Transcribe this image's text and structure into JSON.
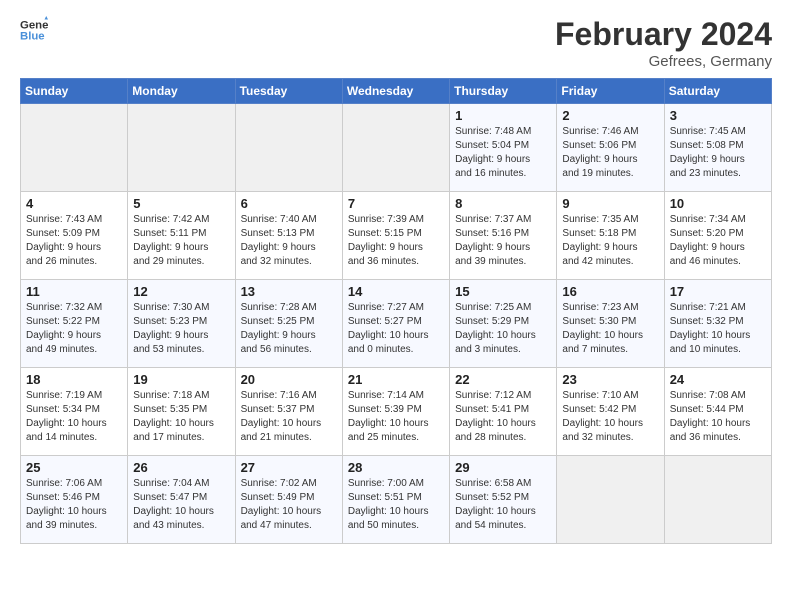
{
  "header": {
    "logo_line1": "General",
    "logo_line2": "Blue",
    "title": "February 2024",
    "subtitle": "Gefrees, Germany"
  },
  "weekdays": [
    "Sunday",
    "Monday",
    "Tuesday",
    "Wednesday",
    "Thursday",
    "Friday",
    "Saturday"
  ],
  "weeks": [
    [
      {
        "day": "",
        "info": ""
      },
      {
        "day": "",
        "info": ""
      },
      {
        "day": "",
        "info": ""
      },
      {
        "day": "",
        "info": ""
      },
      {
        "day": "1",
        "info": "Sunrise: 7:48 AM\nSunset: 5:04 PM\nDaylight: 9 hours\nand 16 minutes."
      },
      {
        "day": "2",
        "info": "Sunrise: 7:46 AM\nSunset: 5:06 PM\nDaylight: 9 hours\nand 19 minutes."
      },
      {
        "day": "3",
        "info": "Sunrise: 7:45 AM\nSunset: 5:08 PM\nDaylight: 9 hours\nand 23 minutes."
      }
    ],
    [
      {
        "day": "4",
        "info": "Sunrise: 7:43 AM\nSunset: 5:09 PM\nDaylight: 9 hours\nand 26 minutes."
      },
      {
        "day": "5",
        "info": "Sunrise: 7:42 AM\nSunset: 5:11 PM\nDaylight: 9 hours\nand 29 minutes."
      },
      {
        "day": "6",
        "info": "Sunrise: 7:40 AM\nSunset: 5:13 PM\nDaylight: 9 hours\nand 32 minutes."
      },
      {
        "day": "7",
        "info": "Sunrise: 7:39 AM\nSunset: 5:15 PM\nDaylight: 9 hours\nand 36 minutes."
      },
      {
        "day": "8",
        "info": "Sunrise: 7:37 AM\nSunset: 5:16 PM\nDaylight: 9 hours\nand 39 minutes."
      },
      {
        "day": "9",
        "info": "Sunrise: 7:35 AM\nSunset: 5:18 PM\nDaylight: 9 hours\nand 42 minutes."
      },
      {
        "day": "10",
        "info": "Sunrise: 7:34 AM\nSunset: 5:20 PM\nDaylight: 9 hours\nand 46 minutes."
      }
    ],
    [
      {
        "day": "11",
        "info": "Sunrise: 7:32 AM\nSunset: 5:22 PM\nDaylight: 9 hours\nand 49 minutes."
      },
      {
        "day": "12",
        "info": "Sunrise: 7:30 AM\nSunset: 5:23 PM\nDaylight: 9 hours\nand 53 minutes."
      },
      {
        "day": "13",
        "info": "Sunrise: 7:28 AM\nSunset: 5:25 PM\nDaylight: 9 hours\nand 56 minutes."
      },
      {
        "day": "14",
        "info": "Sunrise: 7:27 AM\nSunset: 5:27 PM\nDaylight: 10 hours\nand 0 minutes."
      },
      {
        "day": "15",
        "info": "Sunrise: 7:25 AM\nSunset: 5:29 PM\nDaylight: 10 hours\nand 3 minutes."
      },
      {
        "day": "16",
        "info": "Sunrise: 7:23 AM\nSunset: 5:30 PM\nDaylight: 10 hours\nand 7 minutes."
      },
      {
        "day": "17",
        "info": "Sunrise: 7:21 AM\nSunset: 5:32 PM\nDaylight: 10 hours\nand 10 minutes."
      }
    ],
    [
      {
        "day": "18",
        "info": "Sunrise: 7:19 AM\nSunset: 5:34 PM\nDaylight: 10 hours\nand 14 minutes."
      },
      {
        "day": "19",
        "info": "Sunrise: 7:18 AM\nSunset: 5:35 PM\nDaylight: 10 hours\nand 17 minutes."
      },
      {
        "day": "20",
        "info": "Sunrise: 7:16 AM\nSunset: 5:37 PM\nDaylight: 10 hours\nand 21 minutes."
      },
      {
        "day": "21",
        "info": "Sunrise: 7:14 AM\nSunset: 5:39 PM\nDaylight: 10 hours\nand 25 minutes."
      },
      {
        "day": "22",
        "info": "Sunrise: 7:12 AM\nSunset: 5:41 PM\nDaylight: 10 hours\nand 28 minutes."
      },
      {
        "day": "23",
        "info": "Sunrise: 7:10 AM\nSunset: 5:42 PM\nDaylight: 10 hours\nand 32 minutes."
      },
      {
        "day": "24",
        "info": "Sunrise: 7:08 AM\nSunset: 5:44 PM\nDaylight: 10 hours\nand 36 minutes."
      }
    ],
    [
      {
        "day": "25",
        "info": "Sunrise: 7:06 AM\nSunset: 5:46 PM\nDaylight: 10 hours\nand 39 minutes."
      },
      {
        "day": "26",
        "info": "Sunrise: 7:04 AM\nSunset: 5:47 PM\nDaylight: 10 hours\nand 43 minutes."
      },
      {
        "day": "27",
        "info": "Sunrise: 7:02 AM\nSunset: 5:49 PM\nDaylight: 10 hours\nand 47 minutes."
      },
      {
        "day": "28",
        "info": "Sunrise: 7:00 AM\nSunset: 5:51 PM\nDaylight: 10 hours\nand 50 minutes."
      },
      {
        "day": "29",
        "info": "Sunrise: 6:58 AM\nSunset: 5:52 PM\nDaylight: 10 hours\nand 54 minutes."
      },
      {
        "day": "",
        "info": ""
      },
      {
        "day": "",
        "info": ""
      }
    ]
  ]
}
